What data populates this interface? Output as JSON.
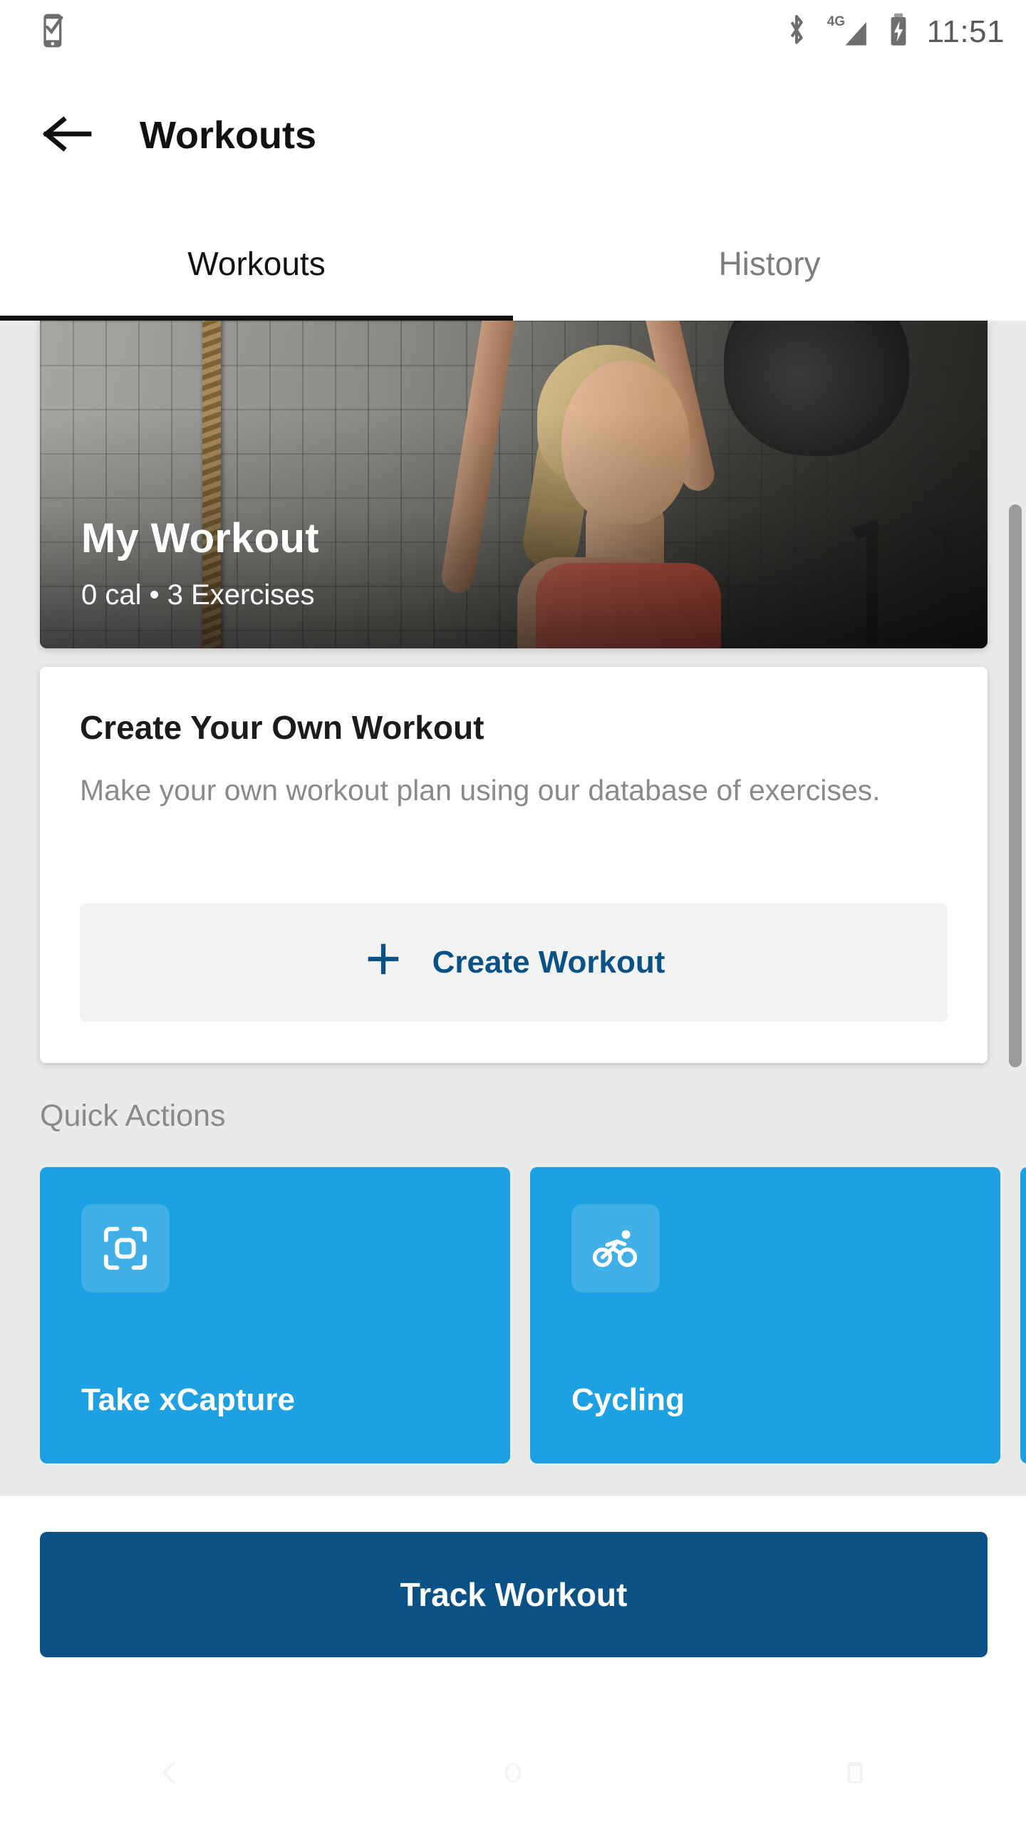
{
  "status_bar": {
    "left_icons": [
      {
        "name": "phone-check-icon",
        "label": "phone-check"
      }
    ],
    "right_icons": [
      {
        "name": "bluetooth-icon",
        "label": "bluetooth"
      },
      {
        "name": "network-4g-icon",
        "label": "4G"
      },
      {
        "name": "battery-charging-icon",
        "label": "battery-charging"
      }
    ],
    "network_label": "4G",
    "clock": "11:51"
  },
  "app_bar": {
    "back_icon": "arrow-left-icon",
    "title": "Workouts"
  },
  "tabs": [
    {
      "label": "Workouts",
      "active": true
    },
    {
      "label": "History",
      "active": false
    }
  ],
  "hero": {
    "title": "My Workout",
    "subtitle": "0 cal • 3 Exercises"
  },
  "create_card": {
    "title": "Create Your Own Workout",
    "description": "Make your own workout plan using our database of exercises.",
    "button_label": "Create Workout",
    "button_icon": "plus-icon"
  },
  "quick_actions": {
    "section_title": "Quick Actions",
    "cards": [
      {
        "label": "Take xCapture",
        "icon": "scan-capture-icon"
      },
      {
        "label": "Cycling",
        "icon": "cycling-icon"
      },
      {
        "label": "",
        "icon": ""
      }
    ]
  },
  "bottom": {
    "track_button_label": "Track Workout"
  },
  "nav_bar": [
    {
      "name": "nav-back-icon"
    },
    {
      "name": "nav-home-icon"
    },
    {
      "name": "nav-recents-icon"
    }
  ],
  "colors": {
    "accent_blue": "#1DA1E2",
    "dark_blue": "#0A5186",
    "page_background": "#EAEAEA",
    "muted_text": "#8a8a8a"
  }
}
